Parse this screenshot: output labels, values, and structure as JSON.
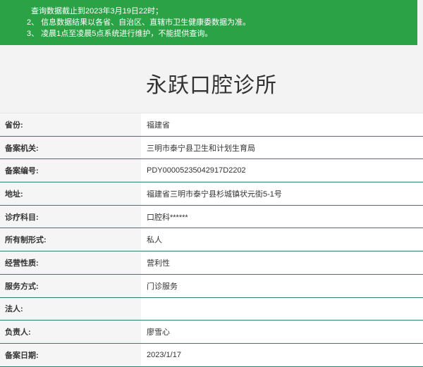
{
  "notice": {
    "lines": [
      "查询数据截止到2023年3月19日22时；",
      "2、 信息数据结果以各省、自治区、直辖市卫生健康委数据为准。",
      "3、 凌晨1点至凌晨5点系统进行维护，不能提供查询。"
    ]
  },
  "title": "永跃口腔诊所",
  "rows": [
    {
      "label": "省份:",
      "value": "福建省"
    },
    {
      "label": "备案机关:",
      "value": "三明市泰宁县卫生和计划生育局"
    },
    {
      "label": "备案编号:",
      "value": "PDY00005235042917D2202"
    },
    {
      "label": "地址:",
      "value": "福建省三明市泰宁县杉城镇状元街5-1号"
    },
    {
      "label": "诊疗科目:",
      "value": "口腔科******"
    },
    {
      "label": "所有制形式:",
      "value": "私人"
    },
    {
      "label": "经营性质:",
      "value": "营利性"
    },
    {
      "label": "服务方式:",
      "value": "门诊服务"
    },
    {
      "label": "法人:",
      "value": ""
    },
    {
      "label": "负责人:",
      "value": "廖雪心"
    },
    {
      "label": "备案日期:",
      "value": "2023/1/17"
    }
  ],
  "colors": {
    "notice_bg": "#2ba245",
    "row_border": "#2f7f6f"
  }
}
